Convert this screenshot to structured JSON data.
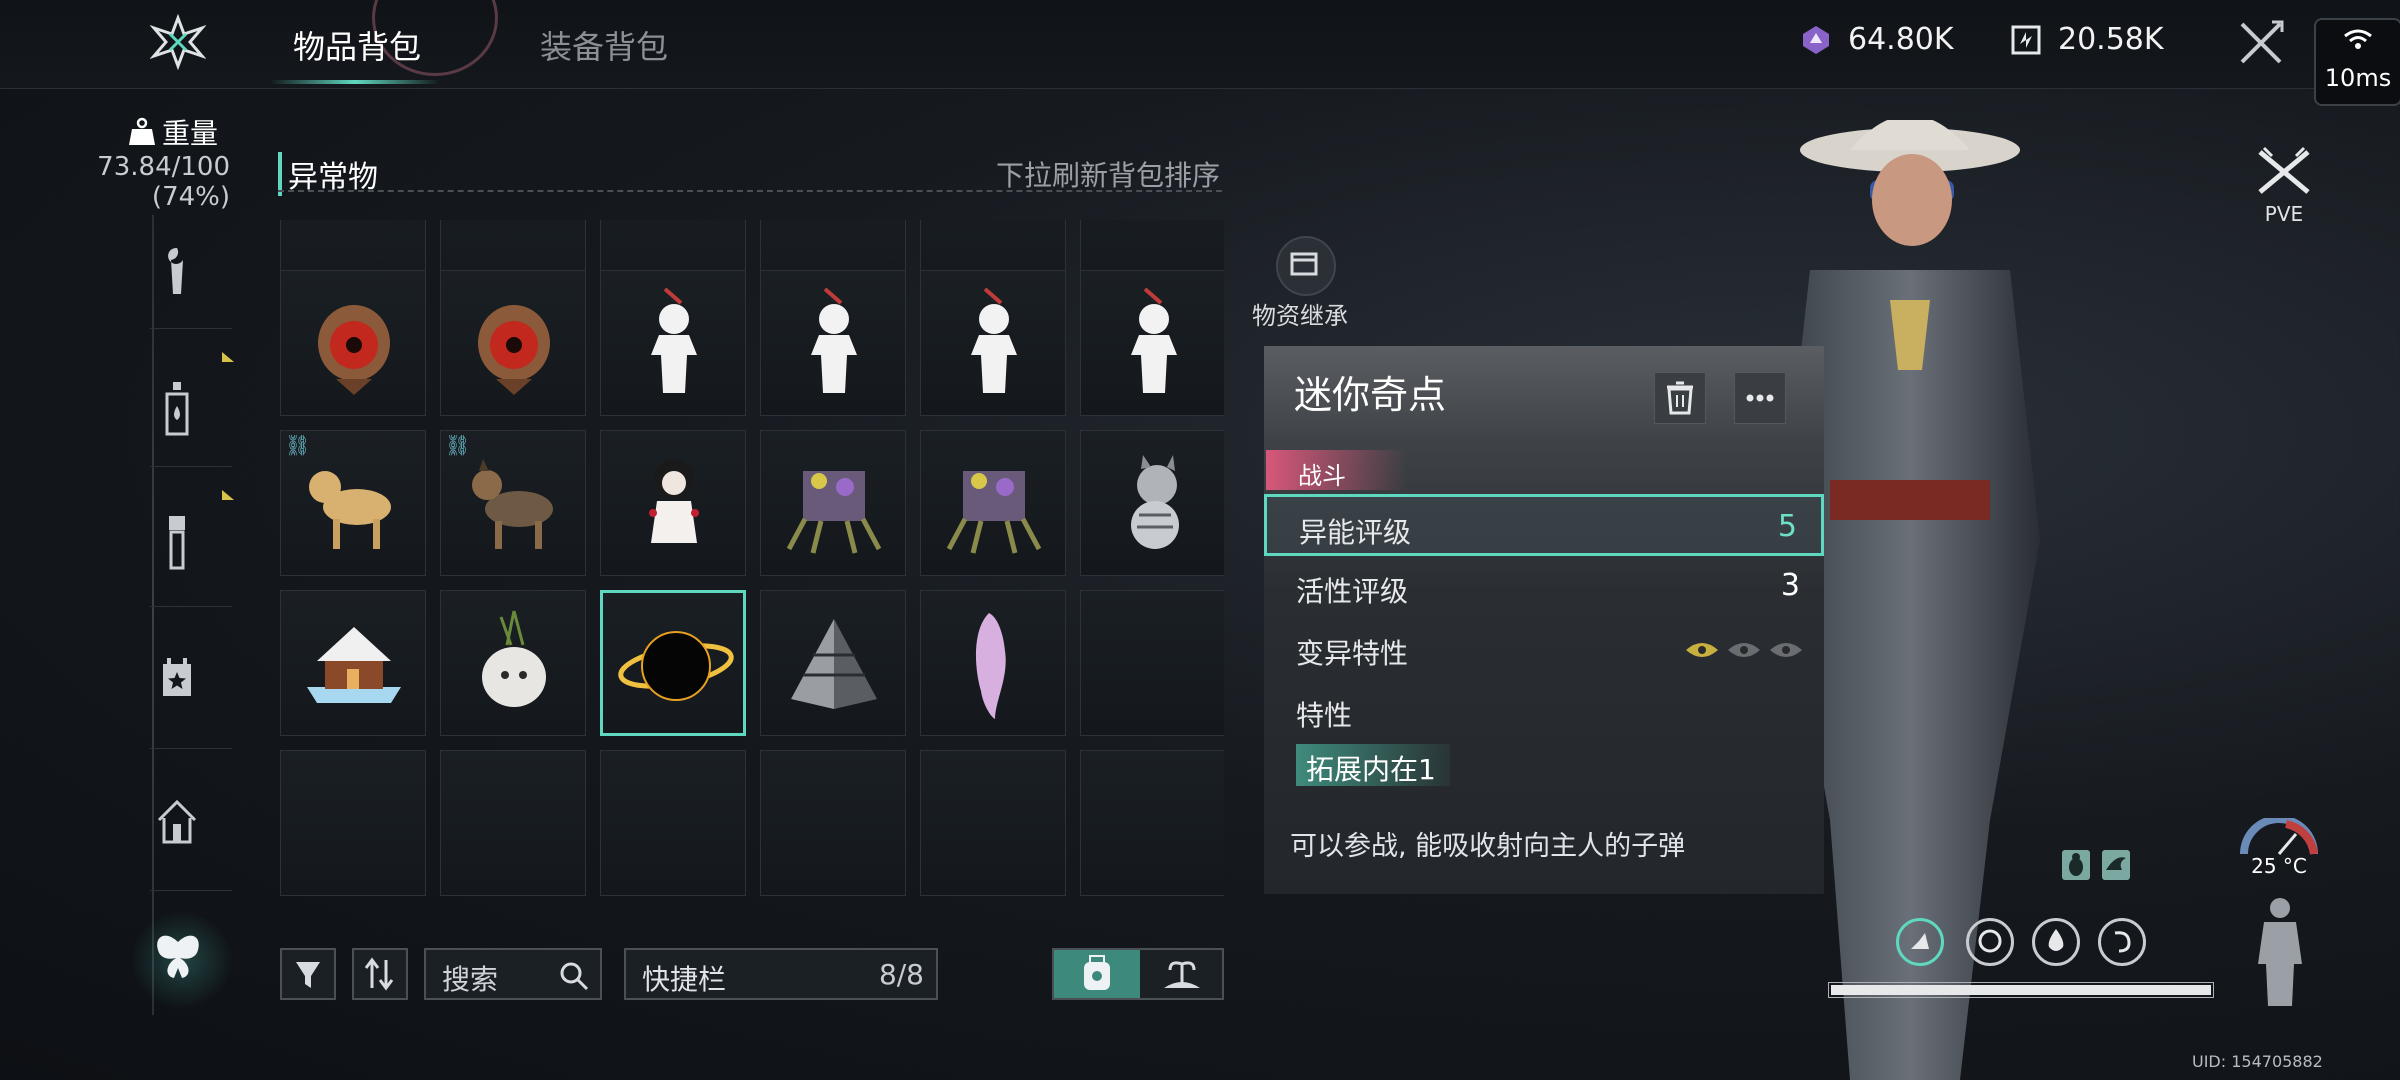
{
  "header": {
    "tabs": [
      {
        "label": "物品背包",
        "active": true
      },
      {
        "label": "装备背包",
        "active": false
      }
    ],
    "currencies": [
      {
        "icon": "crystal-icon",
        "value": "64.80K"
      },
      {
        "icon": "exchange-icon",
        "value": "20.58K"
      }
    ],
    "ping": "10ms"
  },
  "weight": {
    "label": "重量",
    "value": "73.84/100",
    "percent": "(74%)"
  },
  "sidebar": {
    "categories": [
      "wrench-icon",
      "bottle-icon",
      "flashlight-icon",
      "calendar-star-icon",
      "home-icon",
      "butterfly-icon"
    ],
    "active_index": 5
  },
  "inventory": {
    "section_title": "异常物",
    "refresh_hint": "下拉刷新背包排序",
    "rows": [
      [
        "mask-creature",
        "mask-creature",
        "paper-doll",
        "paper-doll",
        "paper-doll",
        "paper-doll"
      ],
      [
        "dog-yellow",
        "dog-shepherd",
        "girl-doll",
        "flower-spider",
        "flower-spider",
        "cat-striped"
      ],
      [
        "gingerbread-house",
        "garlic-bulb",
        "black-hole",
        "pyramid",
        "pink-hair",
        "empty"
      ],
      [
        "empty",
        "empty",
        "empty",
        "empty",
        "empty",
        "empty"
      ]
    ],
    "selected": "black-hole"
  },
  "toolbar": {
    "search_placeholder": "搜索",
    "quickbar_label": "快捷栏",
    "quickbar_count": "8/8"
  },
  "inherit": {
    "label": "物资继承"
  },
  "detail": {
    "name": "迷你奇点",
    "tag": "战斗",
    "stats": [
      {
        "key": "异能评级",
        "value": "5"
      },
      {
        "key": "活性评级",
        "value": "3"
      }
    ],
    "mutation_label": "变异特性",
    "trait_label": "特性",
    "trait_value": "拓展内在1",
    "description": "可以参战, 能吸收射向主人的子弹"
  },
  "status": {
    "mode": "PVE",
    "temperature": "25 °C",
    "uid": "UID: 154705882"
  },
  "colors": {
    "accent": "#5fd8c0",
    "tag": "#d8577a",
    "marker": "#d9c24a"
  }
}
